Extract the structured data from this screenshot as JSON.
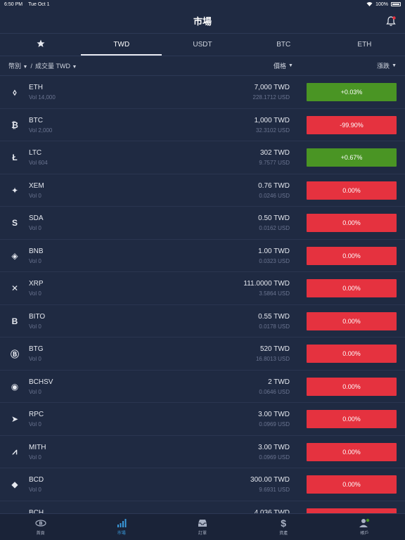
{
  "status_bar": {
    "time": "6:50 PM",
    "date": "Tue Oct 1",
    "battery": "100%"
  },
  "header": {
    "title": "市場"
  },
  "tabs": [
    {
      "label": ""
    },
    {
      "label": "TWD"
    },
    {
      "label": "USDT"
    },
    {
      "label": "BTC"
    },
    {
      "label": "ETH"
    }
  ],
  "filter": {
    "currency_label": "幣別",
    "separator": "/",
    "volume_label": "成交量 TWD",
    "price_label": "價格",
    "change_label": "漲跌"
  },
  "coins": [
    {
      "name": "ETH",
      "vol": "Vol 14,000",
      "price": "7,000 TWD",
      "usd": "228.1712 USD",
      "change": "+0.03%",
      "up": true,
      "icon": "ethereum-icon"
    },
    {
      "name": "BTC",
      "vol": "Vol 2,000",
      "price": "1,000 TWD",
      "usd": "32.3102 USD",
      "change": "-99.90%",
      "up": false,
      "icon": "bitcoin-icon"
    },
    {
      "name": "LTC",
      "vol": "Vol 604",
      "price": "302 TWD",
      "usd": "9.7577 USD",
      "change": "+0.67%",
      "up": true,
      "icon": "litecoin-icon"
    },
    {
      "name": "XEM",
      "vol": "Vol 0",
      "price": "0.76 TWD",
      "usd": "0.0246 USD",
      "change": "0.00%",
      "up": false,
      "icon": "nem-icon"
    },
    {
      "name": "SDA",
      "vol": "Vol 0",
      "price": "0.50 TWD",
      "usd": "0.0162 USD",
      "change": "0.00%",
      "up": false,
      "icon": "sda-icon"
    },
    {
      "name": "BNB",
      "vol": "Vol 0",
      "price": "1.00 TWD",
      "usd": "0.0323 USD",
      "change": "0.00%",
      "up": false,
      "icon": "binance-icon"
    },
    {
      "name": "XRP",
      "vol": "Vol 0",
      "price": "111.0000 TWD",
      "usd": "3.5864 USD",
      "change": "0.00%",
      "up": false,
      "icon": "ripple-icon"
    },
    {
      "name": "BITO",
      "vol": "Vol 0",
      "price": "0.55 TWD",
      "usd": "0.0178 USD",
      "change": "0.00%",
      "up": false,
      "icon": "bito-icon"
    },
    {
      "name": "BTG",
      "vol": "Vol 0",
      "price": "520 TWD",
      "usd": "16.8013 USD",
      "change": "0.00%",
      "up": false,
      "icon": "bitcoin-gold-icon"
    },
    {
      "name": "BCHSV",
      "vol": "Vol 0",
      "price": "2 TWD",
      "usd": "0.0646 USD",
      "change": "0.00%",
      "up": false,
      "icon": "bchsv-icon"
    },
    {
      "name": "RPC",
      "vol": "Vol 0",
      "price": "3.00 TWD",
      "usd": "0.0969 USD",
      "change": "0.00%",
      "up": false,
      "icon": "rpc-icon"
    },
    {
      "name": "MITH",
      "vol": "Vol 0",
      "price": "3.00 TWD",
      "usd": "0.0969 USD",
      "change": "0.00%",
      "up": false,
      "icon": "mithril-icon"
    },
    {
      "name": "BCD",
      "vol": "Vol 0",
      "price": "300.00 TWD",
      "usd": "9.6931 USD",
      "change": "0.00%",
      "up": false,
      "icon": "bitcoin-diamond-icon"
    },
    {
      "name": "BCH",
      "vol": "",
      "price": "4,036 TWD",
      "usd": "",
      "change": "",
      "up": false,
      "icon": "bitcoin-cash-icon"
    }
  ],
  "bottom_nav": [
    {
      "label": "首頁",
      "icon": "home-logo-icon"
    },
    {
      "label": "市場",
      "icon": "market-chart-icon"
    },
    {
      "label": "訂單",
      "icon": "orders-tray-icon"
    },
    {
      "label": "資產",
      "icon": "assets-dollar-icon"
    },
    {
      "label": "帳戶",
      "icon": "account-user-icon"
    }
  ],
  "colors": {
    "up": "#4a9524",
    "down": "#e5323f",
    "active_nav": "#3a9bde"
  }
}
